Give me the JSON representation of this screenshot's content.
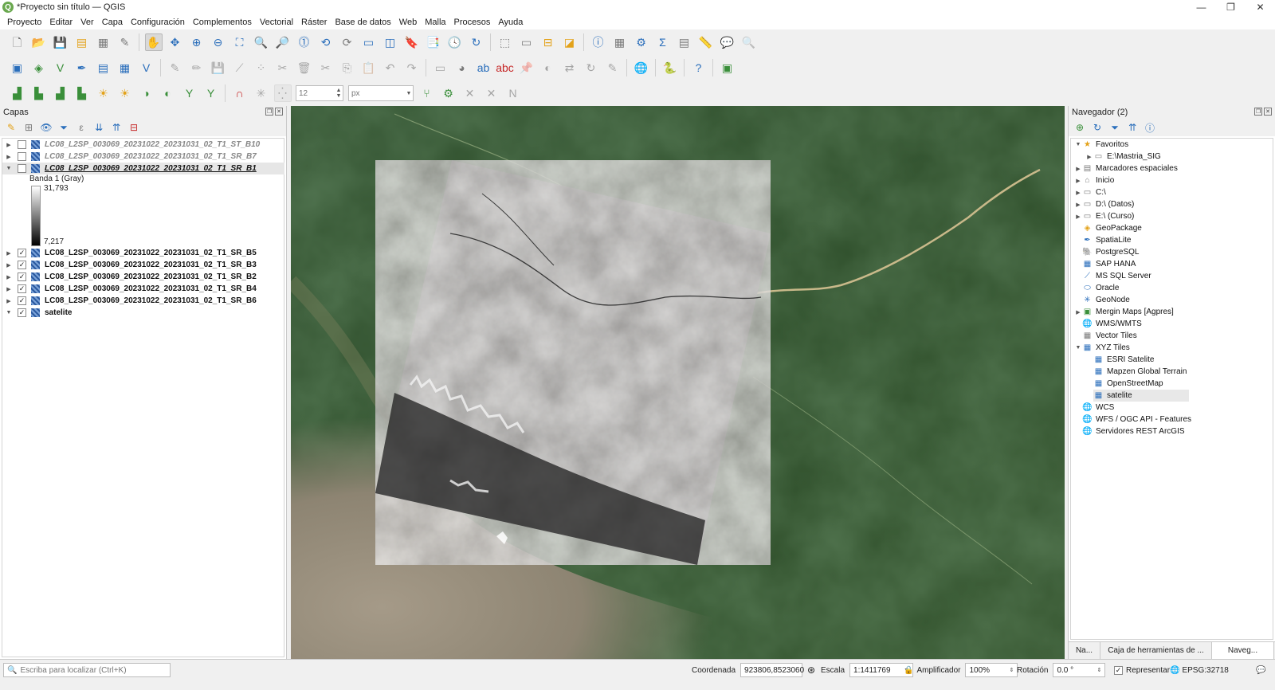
{
  "window": {
    "title": "*Proyecto sin título — QGIS",
    "controls": [
      "minimize",
      "restore",
      "close"
    ]
  },
  "menu": [
    "Proyecto",
    "Editar",
    "Ver",
    "Capa",
    "Configuración",
    "Complementos",
    "Vectorial",
    "Ráster",
    "Base de datos",
    "Web",
    "Malla",
    "Procesos",
    "Ayuda"
  ],
  "toolbar3": {
    "size_value": "12",
    "unit_value": "px"
  },
  "layers_panel": {
    "title": "Capas",
    "items": [
      {
        "name": "LC08_L2SP_003069_20231022_20231031_02_T1_ST_B10",
        "checked": false,
        "state": "muted"
      },
      {
        "name": "LC08_L2SP_003069_20231022_20231031_02_T1_SR_B7",
        "checked": false,
        "state": "muted"
      },
      {
        "name": "LC08_L2SP_003069_20231022_20231031_02_T1_SR_B1",
        "checked": false,
        "state": "selected"
      },
      {
        "name": "LC08_L2SP_003069_20231022_20231031_02_T1_SR_B5",
        "checked": true,
        "state": "normal"
      },
      {
        "name": "LC08_L2SP_003069_20231022_20231031_02_T1_SR_B3",
        "checked": true,
        "state": "normal"
      },
      {
        "name": "LC08_L2SP_003069_20231022_20231031_02_T1_SR_B2",
        "checked": true,
        "state": "normal"
      },
      {
        "name": "LC08_L2SP_003069_20231022_20231031_02_T1_SR_B4",
        "checked": true,
        "state": "normal"
      },
      {
        "name": "LC08_L2SP_003069_20231022_20231031_02_T1_SR_B6",
        "checked": true,
        "state": "normal"
      },
      {
        "name": "satelite",
        "checked": true,
        "state": "normal"
      }
    ],
    "legend": {
      "band": "Banda 1 (Gray)",
      "max": "31,793",
      "min": "7,217"
    }
  },
  "browser_panel": {
    "title": "Navegador (2)",
    "items": [
      {
        "label": "Favoritos",
        "icon": "star-icon"
      },
      {
        "label": "E:\\Mastria_SIG",
        "icon": "folder-icon"
      },
      {
        "label": "Marcadores espaciales",
        "icon": "bookmark-icon"
      },
      {
        "label": "Inicio",
        "icon": "home-icon"
      },
      {
        "label": "C:\\",
        "icon": "folder-icon"
      },
      {
        "label": "D:\\ (Datos)",
        "icon": "folder-icon"
      },
      {
        "label": "E:\\ (Curso)",
        "icon": "folder-icon"
      },
      {
        "label": "GeoPackage",
        "icon": "geopackage-icon"
      },
      {
        "label": "SpatiaLite",
        "icon": "spatialite-icon"
      },
      {
        "label": "PostgreSQL",
        "icon": "postgresql-icon"
      },
      {
        "label": "SAP HANA",
        "icon": "sap-hana-icon"
      },
      {
        "label": "MS SQL Server",
        "icon": "mssql-icon"
      },
      {
        "label": "Oracle",
        "icon": "oracle-icon"
      },
      {
        "label": "GeoNode",
        "icon": "geonode-icon"
      },
      {
        "label": "Mergin Maps [Agpres]",
        "icon": "mergin-icon"
      },
      {
        "label": "WMS/WMTS",
        "icon": "globe-icon"
      },
      {
        "label": "Vector Tiles",
        "icon": "grid-icon"
      },
      {
        "label": "XYZ Tiles",
        "icon": "grid-icon"
      },
      {
        "label": "ESRI Satelite",
        "icon": "grid-icon"
      },
      {
        "label": "Mapzen Global Terrain",
        "icon": "grid-icon"
      },
      {
        "label": "OpenStreetMap",
        "icon": "grid-icon"
      },
      {
        "label": "satelite",
        "icon": "grid-icon"
      },
      {
        "label": "WCS",
        "icon": "globe-icon"
      },
      {
        "label": "WFS / OGC API - Features",
        "icon": "globe-icon"
      },
      {
        "label": "Servidores REST ArcGIS",
        "icon": "globe-icon"
      }
    ],
    "tabs": [
      "Na...",
      "Caja de herramientas de ...",
      "Naveg..."
    ]
  },
  "statusbar": {
    "locator_placeholder": "Escriba para localizar (Ctrl+K)",
    "coord_label": "Coordenada",
    "coord_value": "923806,8523060",
    "scale_label": "Escala",
    "scale_value": "1:1411769",
    "magnifier_label": "Amplificador",
    "magnifier_value": "100%",
    "rotation_label": "Rotación",
    "rotation_value": "0.0 °",
    "render_label": "Representar",
    "crs_value": "EPSG:32718"
  }
}
